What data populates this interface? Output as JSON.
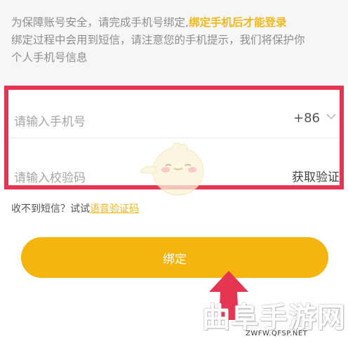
{
  "notice": {
    "line1_prefix": "为保障账号安全，请完成手机号绑定,",
    "line1_highlight": "绑定手机后才能登录",
    "line2": "绑定过程中会用到短信，请注意您的手机提示，我们将保护你",
    "line3": "个人手机号信息"
  },
  "form": {
    "phone_placeholder": "请输入手机号",
    "country_code": "+86",
    "code_placeholder": "请输入校验码",
    "get_code_label": "获取验证"
  },
  "voice": {
    "prefix": "收不到短信？试试",
    "link_label": "语音验证码"
  },
  "bind_button_label": "绑定",
  "watermark": {
    "title": "曲阜手游网",
    "url": "ZWFW.QFSP.NET"
  },
  "colors": {
    "accent": "#f5b50e",
    "highlight_text": "#f2b81c",
    "annotation_red": "#e63552"
  },
  "icons": {
    "country_dropdown": "chevron-down-icon",
    "annotation_arrow": "arrow-up-icon"
  }
}
